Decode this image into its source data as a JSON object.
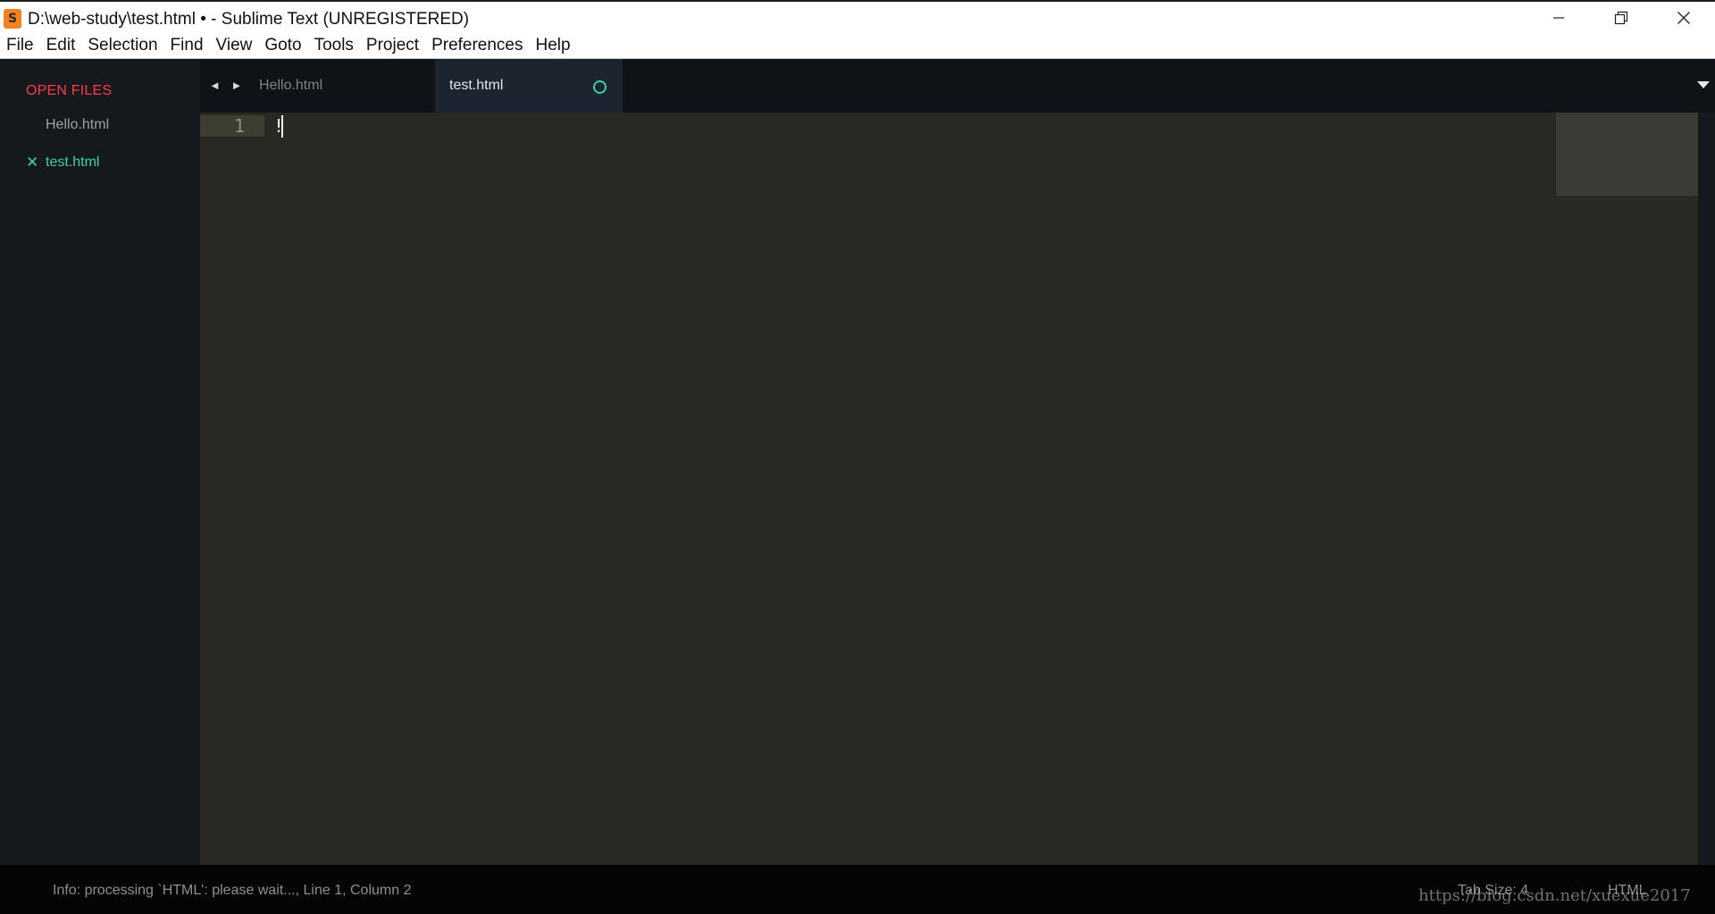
{
  "window": {
    "title": "D:\\web-study\\test.html • - Sublime Text (UNREGISTERED)",
    "logo_letter": "S",
    "controls": {
      "minimize": "—",
      "maximize": "❐",
      "close": "✕"
    }
  },
  "menubar": {
    "items": [
      "File",
      "Edit",
      "Selection",
      "Find",
      "View",
      "Goto",
      "Tools",
      "Project",
      "Preferences",
      "Help"
    ]
  },
  "sidebar": {
    "heading": "OPEN FILES",
    "files": [
      {
        "name": "Hello.html",
        "active": false
      },
      {
        "name": "test.html",
        "active": true,
        "close_glyph": "✕"
      }
    ]
  },
  "tabs": {
    "nav": "◄ ►",
    "items": [
      {
        "label": "Hello.html",
        "active": false
      },
      {
        "label": "test.html",
        "active": true,
        "dirty": true
      }
    ]
  },
  "editor": {
    "line_number": "1",
    "code": "!"
  },
  "statusbar": {
    "info": "Info: processing `HTML': please wait..., Line 1, Column 2",
    "tab_size": "Tab Size: 4",
    "syntax": "HTML"
  },
  "watermark": "https://blog.csdn.net/xuexue2017",
  "colors": {
    "sidebar_heading": "#ff3b47",
    "accent": "#33d4a6",
    "editor_bg": "#282923",
    "sidebar_bg": "#15191e"
  }
}
